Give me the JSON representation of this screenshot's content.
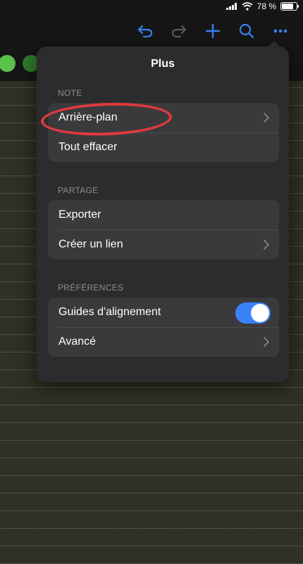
{
  "status": {
    "battery": "78 %",
    "battery_level": 0.78
  },
  "colors": {
    "accent": "#3a82f7",
    "highlight": "#e0393e",
    "swatch_green": "#5ac24a",
    "swatch_dark_green": "#2f7d2b"
  },
  "toolbar": {
    "icons": [
      "undo-icon",
      "redo-icon",
      "plus-icon",
      "search-icon",
      "more-icon"
    ]
  },
  "popover": {
    "title": "Plus",
    "sections": [
      {
        "label": "NOTE",
        "items": [
          {
            "label": "Arrière-plan",
            "chevron": true
          },
          {
            "label": "Tout effacer",
            "chevron": false
          }
        ]
      },
      {
        "label": "PARTAGE",
        "items": [
          {
            "label": "Exporter",
            "chevron": false
          },
          {
            "label": "Créer un lien",
            "chevron": true
          }
        ]
      },
      {
        "label": "PRÉFÉRENCES",
        "items": [
          {
            "label": "Guides d'alignement",
            "toggle": true,
            "on": true
          },
          {
            "label": "Avancé",
            "chevron": true
          }
        ]
      }
    ]
  }
}
